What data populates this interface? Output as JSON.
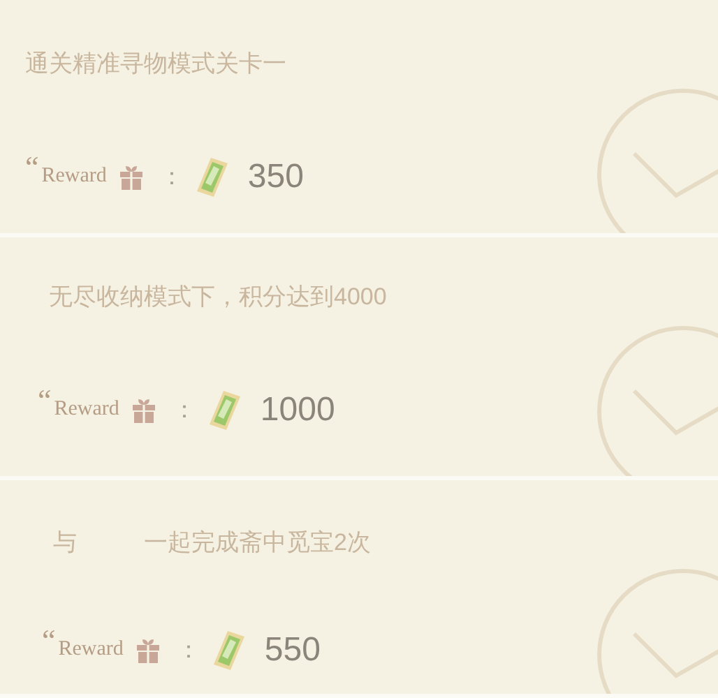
{
  "tasks": [
    {
      "description": [
        "通关精准寻物模式关卡一"
      ],
      "quote_mark": "“",
      "reward_label": "Reward",
      "separator": "：",
      "amount": "350"
    },
    {
      "description": [
        "无尽收纳模式下，积分达到4000"
      ],
      "quote_mark": "“",
      "reward_label": "Reward",
      "separator": "：",
      "amount": "1000"
    },
    {
      "description": [
        "与",
        "一起完成斋中觅宝2次"
      ],
      "quote_mark": "“",
      "reward_label": "Reward",
      "separator": "：",
      "amount": "550"
    }
  ]
}
